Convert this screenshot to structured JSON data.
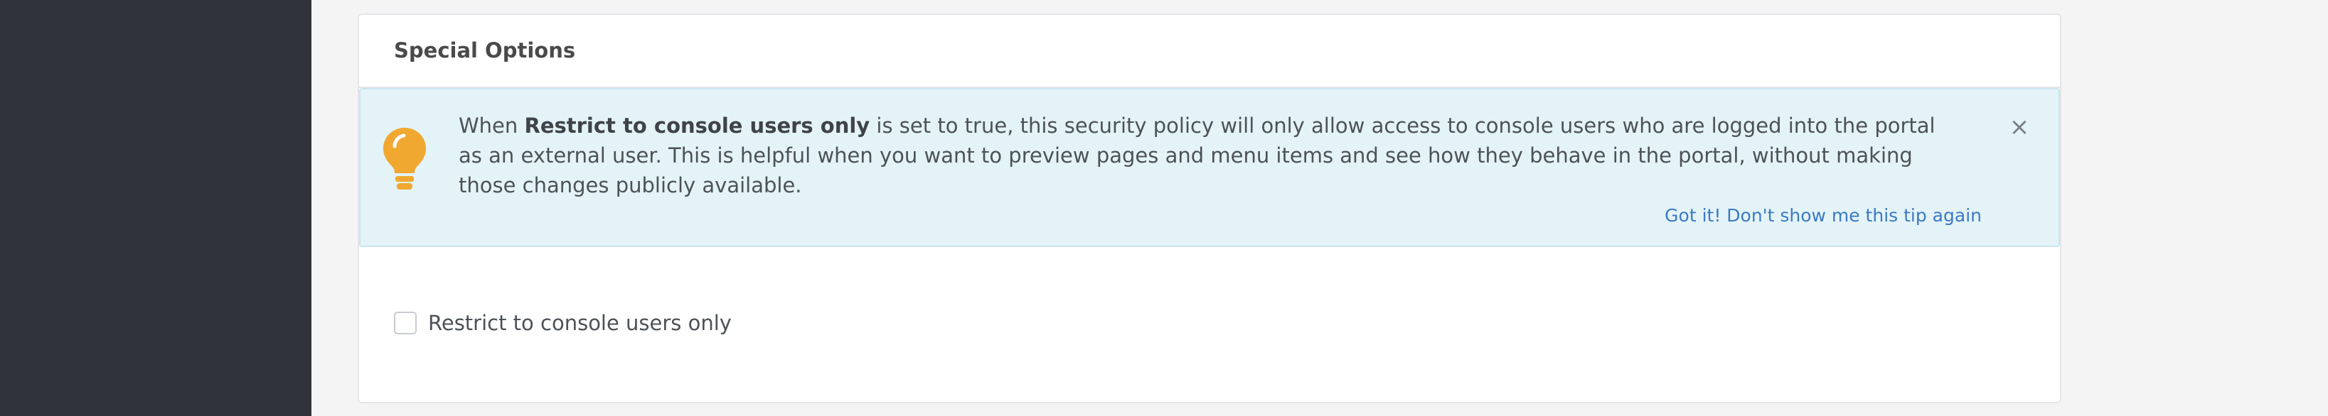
{
  "card": {
    "title": "Special Options"
  },
  "tip": {
    "text_before": "When ",
    "text_bold": "Restrict to console users only",
    "text_after": " is set to true, this security policy will only allow access to console users who are logged into the portal as an external user. This is helpful when you want to preview pages and menu items and see how they behave in the portal, without making those changes publicly available.",
    "close_glyph": "×",
    "dismiss_link": "Got it! Don't show me this tip again",
    "icon": "lightbulb-icon",
    "icon_color": "#f0a830"
  },
  "option": {
    "label": "Restrict to console users only",
    "checked": false
  },
  "colors": {
    "sidebar": "#2f323a",
    "tip_background": "#e3f3f8",
    "link": "#3c7ac2"
  }
}
